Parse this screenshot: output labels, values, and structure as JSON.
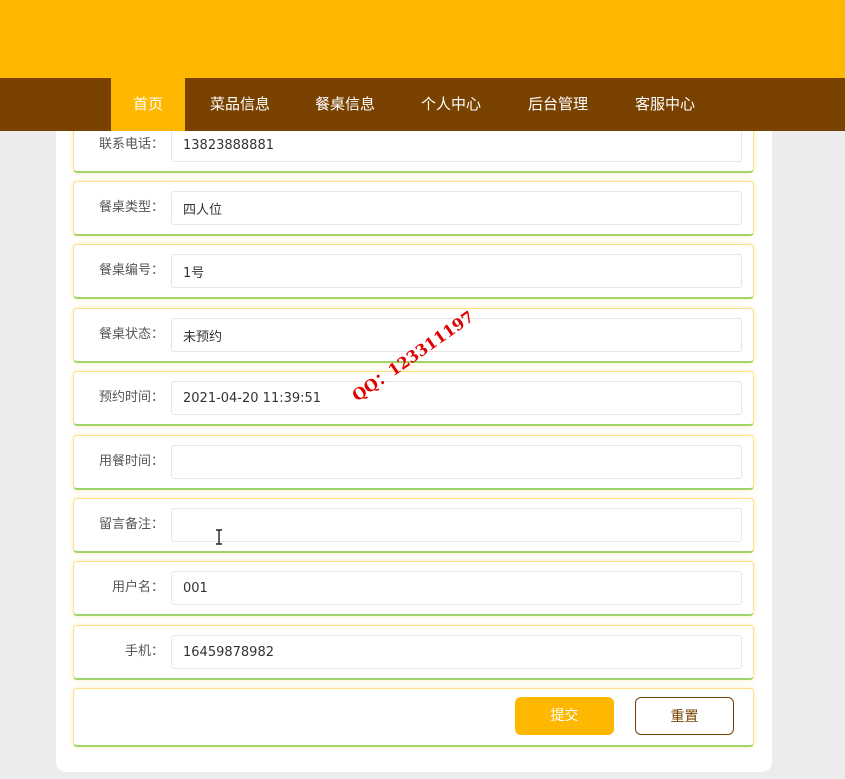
{
  "nav": {
    "items": [
      {
        "label": "首页",
        "active": true
      },
      {
        "label": "菜品信息",
        "active": false
      },
      {
        "label": "餐桌信息",
        "active": false
      },
      {
        "label": "个人中心",
        "active": false
      },
      {
        "label": "后台管理",
        "active": false
      },
      {
        "label": "客服中心",
        "active": false
      }
    ]
  },
  "form": {
    "fields": [
      {
        "label": "联系电话：",
        "value": "13823888881"
      },
      {
        "label": "餐桌类型：",
        "value": "四人位"
      },
      {
        "label": "餐桌编号：",
        "value": "1号"
      },
      {
        "label": "餐桌状态：",
        "value": "未预约"
      },
      {
        "label": "预约时间：",
        "value": "2021-04-20 11:39:51"
      },
      {
        "label": "用餐时间：",
        "value": ""
      },
      {
        "label": "留言备注：",
        "value": ""
      },
      {
        "label": "用户名：",
        "value": "001"
      },
      {
        "label": "手机：",
        "value": "16459878982"
      }
    ],
    "submit_label": "提交",
    "reset_label": "重置"
  },
  "watermark": "QQ：123311197",
  "colors": {
    "banner": "#ffb800",
    "nav": "#7a4200",
    "accent": "#ffb800"
  },
  "cursor": "text-cursor-icon"
}
